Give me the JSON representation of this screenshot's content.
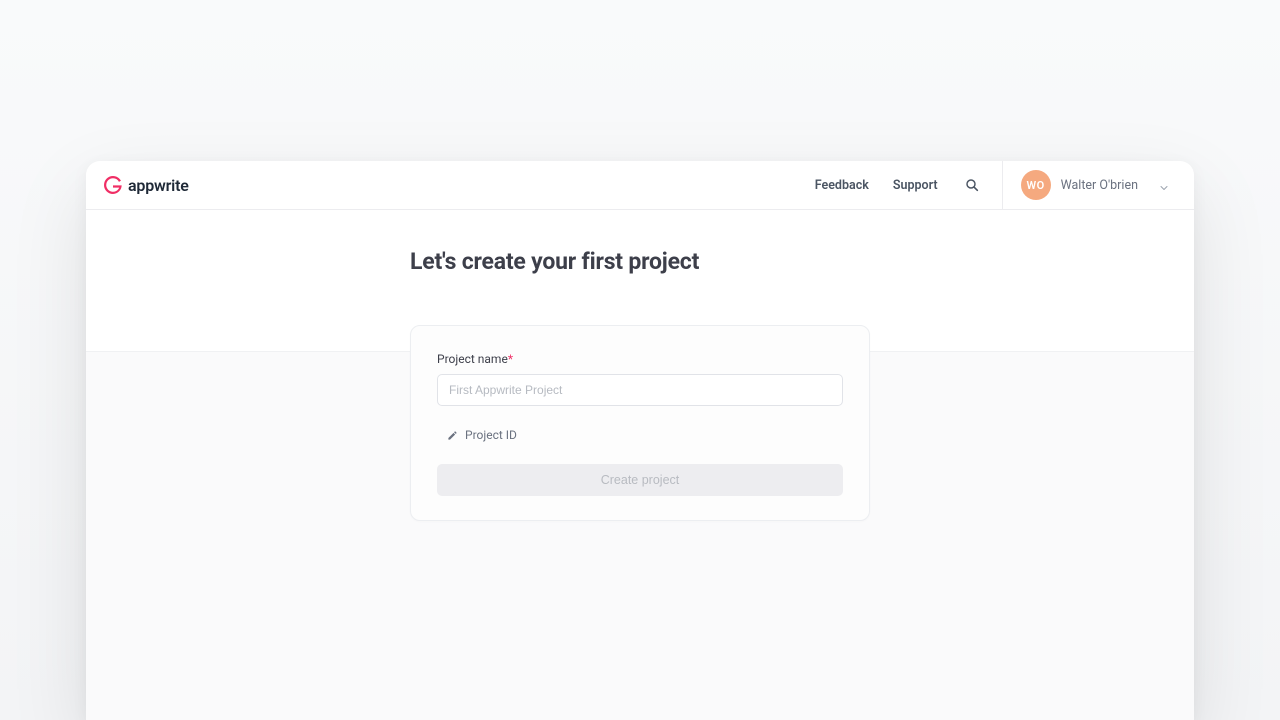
{
  "brand": {
    "name": "appwrite",
    "accent": "#f02e65"
  },
  "header": {
    "feedback_label": "Feedback",
    "support_label": "Support"
  },
  "user": {
    "initials": "WO",
    "name": "Walter O'brien"
  },
  "page": {
    "title": "Let's create your first project"
  },
  "form": {
    "project_name_label": "Project name",
    "project_name_placeholder": "First Appwrite Project",
    "project_name_value": "",
    "project_id_label": "Project ID",
    "submit_label": "Create project"
  }
}
